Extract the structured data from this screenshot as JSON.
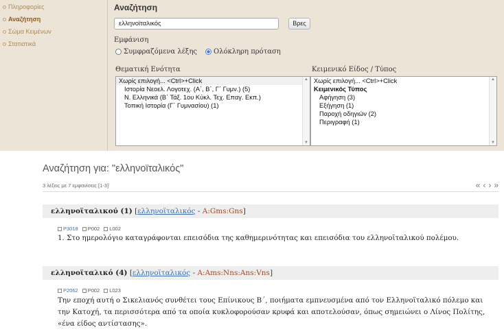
{
  "sidebar": {
    "items": [
      {
        "label": "Πληροφορίες"
      },
      {
        "label": "Αναζήτηση"
      },
      {
        "label": "Σώμα Κειμένων"
      },
      {
        "label": "Στατιστικά"
      }
    ]
  },
  "search": {
    "title": "Αναζήτηση",
    "value": "ελληνοϊταλικός",
    "button": "Βρες",
    "display_label": "Εμφάνιση",
    "option_context": "Συμφραζόμενα λέξης",
    "option_sentence": "Ολόκληρη πρόταση",
    "thematic_label": "Θεματική Ενότητα",
    "genre_label": "Κειμενικό Είδος / Τύπος",
    "thematic_options": [
      "Χωρίς επιλογή...  <Ctrl>+Click",
      "Ιστορία Νεοελ. Λογοτεχ. (Α΄, Β΄, Γ΄ Γυμν.) (5)",
      "Ν. Ελληνικά (Β΄ Τάξ. 1ου Κύκλ. Τεχ. Επαγ. Εκπ.)",
      "Τοπική Ιστορία (Γ΄ Γυμνασίου) (1)"
    ],
    "genre_options": [
      "Χωρίς επιλογή...  <Ctrl>+Click",
      "Κειμενικός Τύπος",
      "Αφήγηση (3)",
      "Εξήγηση (1)",
      "Παροχή οδηγιών (2)",
      "Περιγραφή (1)"
    ]
  },
  "results": {
    "title": "Αναζήτηση για: \"ελληνοϊταλικός\"",
    "count": "3 λέξεις με 7 εμφανίσεις [1-3]",
    "pager": [
      "«",
      "‹",
      "›",
      "»"
    ],
    "hits": [
      {
        "word": "ελληνοϊταλικού (1)",
        "lemma": "ελληνοϊταλικός",
        "sep": " - ",
        "morph": "A:Gms:Gns",
        "refs": [
          "P3018",
          "P002",
          "L002"
        ],
        "text": "1. Στο ημερολόγιο καταγράφονται επεισόδια της καθημερινότητας και επεισόδια του ελληνοϊταλικού πολέμου."
      },
      {
        "word": "ελληνοϊταλικό (4)",
        "lemma": "ελληνοϊταλικός",
        "sep": " - ",
        "morph": "A:Ams:Nns:Ans:Vns",
        "refs": [
          "P2062",
          "P002",
          "L023"
        ],
        "text": "Την εποχή αυτή ο Σικελιανός συνθέτει τους Επίνικους Β΄, ποιήματα εμπνευσμένα από τον Ελληνοϊταλικό πόλεμο και την Κατοχή, τα περισσότερα από τα οποία κυκλοφορούσαν κρυφά και αποτελούσαν, όπως σημειώνει ο Λίνος Πολίτης, «ένα είδος αντίστασης»."
      }
    ]
  }
}
